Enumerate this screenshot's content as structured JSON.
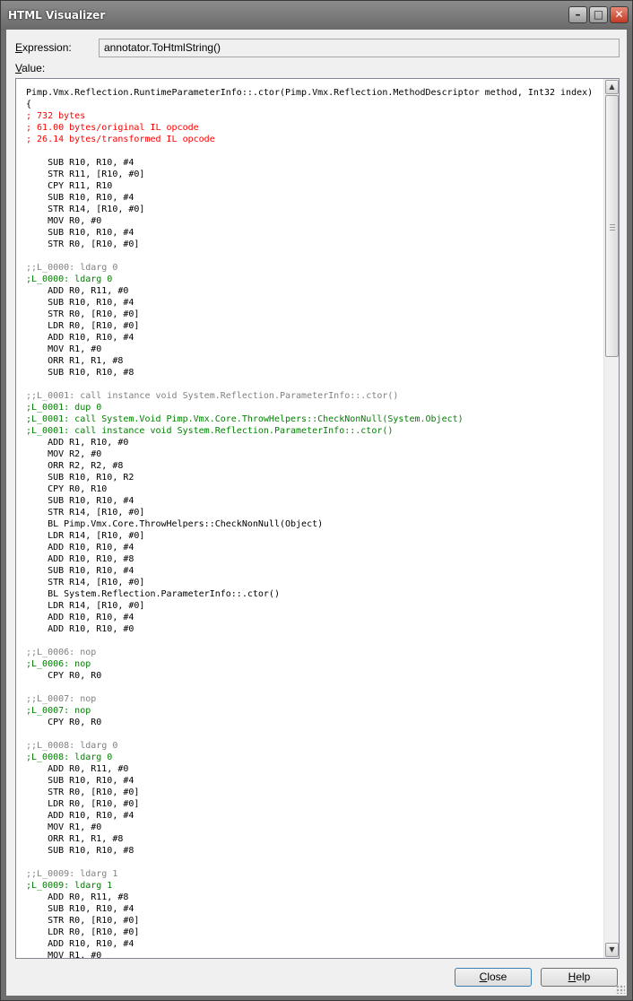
{
  "window": {
    "title": "HTML Visualizer",
    "minimize_glyph": "–",
    "maximize_glyph": "□",
    "close_glyph": "✕"
  },
  "expression": {
    "label": "Expression:",
    "value": "annotator.ToHtmlString()"
  },
  "value_label": "Value:",
  "code_lines": [
    {
      "t": "Pimp.Vmx.Reflection.RuntimeParameterInfo::.ctor(Pimp.Vmx.Reflection.MethodDescriptor method, Int32 index)",
      "c": "black"
    },
    {
      "t": "{",
      "c": "black"
    },
    {
      "t": "; 732 bytes",
      "c": "red"
    },
    {
      "t": "; 61.00 bytes/original IL opcode",
      "c": "red"
    },
    {
      "t": "; 26.14 bytes/transformed IL opcode",
      "c": "red"
    },
    {
      "t": "",
      "c": "black"
    },
    {
      "t": "    SUB R10, R10, #4",
      "c": "black"
    },
    {
      "t": "    STR R11, [R10, #0]",
      "c": "black"
    },
    {
      "t": "    CPY R11, R10",
      "c": "black"
    },
    {
      "t": "    SUB R10, R10, #4",
      "c": "black"
    },
    {
      "t": "    STR R14, [R10, #0]",
      "c": "black"
    },
    {
      "t": "    MOV R0, #0",
      "c": "black"
    },
    {
      "t": "    SUB R10, R10, #4",
      "c": "black"
    },
    {
      "t": "    STR R0, [R10, #0]",
      "c": "black"
    },
    {
      "t": "",
      "c": "black"
    },
    {
      "t": ";;L_0000: ldarg 0",
      "c": "gray"
    },
    {
      "t": ";L_0000: ldarg 0",
      "c": "green"
    },
    {
      "t": "    ADD R0, R11, #0",
      "c": "black"
    },
    {
      "t": "    SUB R10, R10, #4",
      "c": "black"
    },
    {
      "t": "    STR R0, [R10, #0]",
      "c": "black"
    },
    {
      "t": "    LDR R0, [R10, #0]",
      "c": "black"
    },
    {
      "t": "    ADD R10, R10, #4",
      "c": "black"
    },
    {
      "t": "    MOV R1, #0",
      "c": "black"
    },
    {
      "t": "    ORR R1, R1, #8",
      "c": "black"
    },
    {
      "t": "    SUB R10, R10, #8",
      "c": "black"
    },
    {
      "t": "",
      "c": "black"
    },
    {
      "t": ";;L_0001: call instance void System.Reflection.ParameterInfo::.ctor()",
      "c": "gray"
    },
    {
      "t": ";L_0001: dup 0",
      "c": "green"
    },
    {
      "t": ";L_0001: call System.Void Pimp.Vmx.Core.ThrowHelpers::CheckNonNull(System.Object)",
      "c": "green"
    },
    {
      "t": ";L_0001: call instance void System.Reflection.ParameterInfo::.ctor()",
      "c": "green"
    },
    {
      "t": "    ADD R1, R10, #0",
      "c": "black"
    },
    {
      "t": "    MOV R2, #0",
      "c": "black"
    },
    {
      "t": "    ORR R2, R2, #8",
      "c": "black"
    },
    {
      "t": "    SUB R10, R10, R2",
      "c": "black"
    },
    {
      "t": "    CPY R0, R10",
      "c": "black"
    },
    {
      "t": "    SUB R10, R10, #4",
      "c": "black"
    },
    {
      "t": "    STR R14, [R10, #0]",
      "c": "black"
    },
    {
      "t": "    BL Pimp.Vmx.Core.ThrowHelpers::CheckNonNull(Object)",
      "c": "black"
    },
    {
      "t": "    LDR R14, [R10, #0]",
      "c": "black"
    },
    {
      "t": "    ADD R10, R10, #4",
      "c": "black"
    },
    {
      "t": "    ADD R10, R10, #8",
      "c": "black"
    },
    {
      "t": "    SUB R10, R10, #4",
      "c": "black"
    },
    {
      "t": "    STR R14, [R10, #0]",
      "c": "black"
    },
    {
      "t": "    BL System.Reflection.ParameterInfo::.ctor()",
      "c": "black"
    },
    {
      "t": "    LDR R14, [R10, #0]",
      "c": "black"
    },
    {
      "t": "    ADD R10, R10, #4",
      "c": "black"
    },
    {
      "t": "    ADD R10, R10, #0",
      "c": "black"
    },
    {
      "t": "",
      "c": "black"
    },
    {
      "t": ";;L_0006: nop",
      "c": "gray"
    },
    {
      "t": ";L_0006: nop",
      "c": "green"
    },
    {
      "t": "    CPY R0, R0",
      "c": "black"
    },
    {
      "t": "",
      "c": "black"
    },
    {
      "t": ";;L_0007: nop",
      "c": "gray"
    },
    {
      "t": ";L_0007: nop",
      "c": "green"
    },
    {
      "t": "    CPY R0, R0",
      "c": "black"
    },
    {
      "t": "",
      "c": "black"
    },
    {
      "t": ";;L_0008: ldarg 0",
      "c": "gray"
    },
    {
      "t": ";L_0008: ldarg 0",
      "c": "green"
    },
    {
      "t": "    ADD R0, R11, #0",
      "c": "black"
    },
    {
      "t": "    SUB R10, R10, #4",
      "c": "black"
    },
    {
      "t": "    STR R0, [R10, #0]",
      "c": "black"
    },
    {
      "t": "    LDR R0, [R10, #0]",
      "c": "black"
    },
    {
      "t": "    ADD R10, R10, #4",
      "c": "black"
    },
    {
      "t": "    MOV R1, #0",
      "c": "black"
    },
    {
      "t": "    ORR R1, R1, #8",
      "c": "black"
    },
    {
      "t": "    SUB R10, R10, #8",
      "c": "black"
    },
    {
      "t": "",
      "c": "black"
    },
    {
      "t": ";;L_0009: ldarg 1",
      "c": "gray"
    },
    {
      "t": ";L_0009: ldarg 1",
      "c": "green"
    },
    {
      "t": "    ADD R0, R11, #8",
      "c": "black"
    },
    {
      "t": "    SUB R10, R10, #4",
      "c": "black"
    },
    {
      "t": "    STR R0, [R10, #0]",
      "c": "black"
    },
    {
      "t": "    LDR R0, [R10, #0]",
      "c": "black"
    },
    {
      "t": "    ADD R10, R10, #4",
      "c": "black"
    },
    {
      "t": "    MOV R1, #0",
      "c": "black"
    }
  ],
  "scrollbar": {
    "up_glyph": "▲",
    "down_glyph": "▼"
  },
  "buttons": {
    "close_label": "Close",
    "help_label": "Help"
  },
  "colors": {
    "comment_red": "#ff0000",
    "original_il_gray": "#808080",
    "transformed_il_green": "#008000"
  },
  "icons": [
    "minimize-icon",
    "maximize-icon",
    "close-icon",
    "scroll-up-arrow-icon",
    "scroll-down-arrow-icon",
    "size-grip-icon"
  ]
}
